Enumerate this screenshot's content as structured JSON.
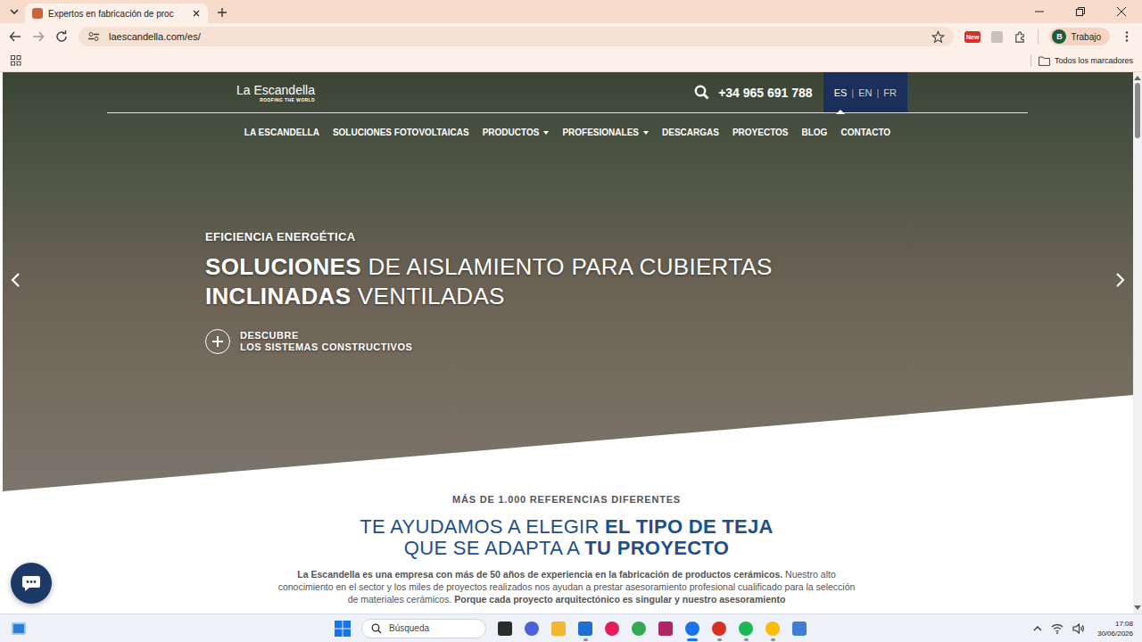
{
  "browser": {
    "tabs": [
      {
        "label": "Expertos en fabricación de proc",
        "selected": true
      }
    ],
    "url": "laescandella.com/es/",
    "extension_badge": "New",
    "profile": {
      "initial": "B",
      "name": "Trabajo"
    },
    "bookmarks_folder": "Todos los marcadores"
  },
  "site": {
    "logo": {
      "name": "La Escandella",
      "tagline": "ROOFING THE WORLD"
    },
    "phone": "+34 965 691 788",
    "languages": [
      {
        "label": "ES",
        "selected": true
      },
      {
        "label": "EN",
        "selected": false
      },
      {
        "label": "FR",
        "selected": false
      }
    ],
    "language_separator": "|",
    "nav": [
      {
        "label": "LA ESCANDELLA",
        "dropdown": false
      },
      {
        "label": "SOLUCIONES FOTOVOLTAICAS",
        "dropdown": false
      },
      {
        "label": "PRODUCTOS",
        "dropdown": true
      },
      {
        "label": "PROFESIONALES",
        "dropdown": true
      },
      {
        "label": "DESCARGAS",
        "dropdown": false
      },
      {
        "label": "PROYECTOS",
        "dropdown": false
      },
      {
        "label": "BLOG",
        "dropdown": false
      },
      {
        "label": "CONTACTO",
        "dropdown": false
      }
    ],
    "hero": {
      "eyebrow": "EFICIENCIA ENERGÉTICA",
      "headline": [
        [
          {
            "text": "SOLUCIONES",
            "bold": true
          },
          {
            "text": " DE AISLAMIENTO PARA CUBIERTAS",
            "bold": false
          }
        ],
        [
          {
            "text": "INCLINADAS",
            "bold": true
          },
          {
            "text": " VENTILADAS",
            "bold": false
          }
        ]
      ],
      "cta": [
        "DESCUBRE",
        "LOS SISTEMAS CONSTRUCTIVOS"
      ]
    },
    "intro": {
      "kicker": "MÁS DE 1.000 REFERENCIAS DIFERENTES",
      "heading": [
        [
          {
            "text": "TE AYUDAMOS A ELEGIR ",
            "bold": false
          },
          {
            "text": "EL TIPO DE TEJA",
            "bold": true
          }
        ],
        [
          {
            "text": "QUE SE ADAPTA A ",
            "bold": false
          },
          {
            "text": "TU PROYECTO",
            "bold": true
          }
        ]
      ],
      "paragraph": [
        {
          "text": "La Escandella es una empresa con más de 50 años de experiencia en la fabricación de productos cerámicos.",
          "bold": true
        },
        {
          "text": " Nuestro alto conocimiento en el sector y los miles de proyectos realizados nos ayudan a prestar asesoramiento profesional cualificado para la selección de materiales cerámicos.",
          "bold": false
        },
        {
          "text": " Porque cada proyecto arquitectónico es singular y nuestro asesoramiento",
          "bold": true
        }
      ]
    }
  },
  "taskbar": {
    "search_placeholder": "Búsqueda",
    "apps": [
      {
        "running": false,
        "active": false
      },
      {
        "running": false,
        "active": false
      },
      {
        "running": false,
        "active": false
      },
      {
        "running": true,
        "active": false
      },
      {
        "running": false,
        "active": false
      },
      {
        "running": false,
        "active": false
      },
      {
        "running": false,
        "active": false
      },
      {
        "running": true,
        "active": true
      },
      {
        "running": true,
        "active": false
      },
      {
        "running": true,
        "active": false
      },
      {
        "running": true,
        "active": false
      },
      {
        "running": false,
        "active": false
      }
    ],
    "time": "17:08",
    "date": "30/06/2026"
  }
}
